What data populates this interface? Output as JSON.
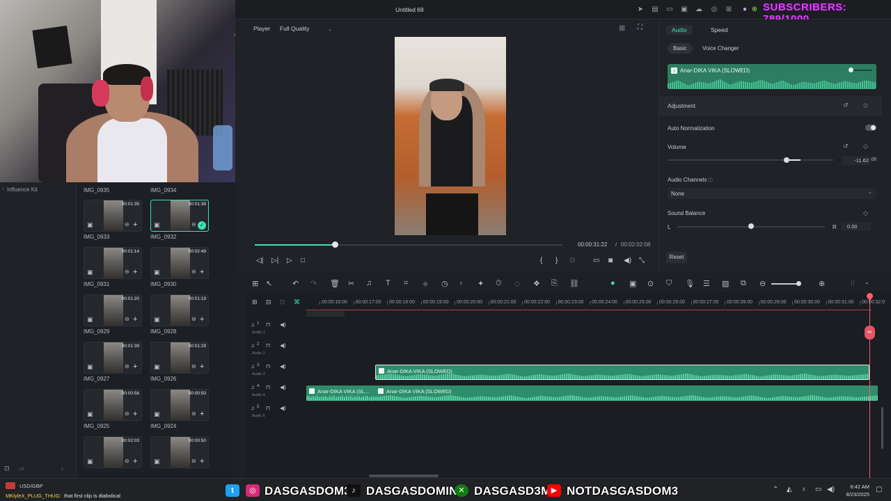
{
  "app": {
    "title": "Untitled 69"
  },
  "overlay": {
    "subscribers": "SUBSCRIBERS: 789/1000"
  },
  "left_panel": {
    "influence_kit": "Influence Kit"
  },
  "media": {
    "top_labels": [
      "IMG_0935",
      "IMG_0934"
    ],
    "items": [
      {
        "name": "IMG_0933",
        "duration": "00:01:35",
        "selected": false
      },
      {
        "name": "IMG_0932",
        "duration": "00:01:38",
        "selected": true
      },
      {
        "name": "IMG_0931",
        "duration": "00:01:14",
        "selected": false
      },
      {
        "name": "IMG_0930",
        "duration": "00:02:49",
        "selected": false
      },
      {
        "name": "IMG_0929",
        "duration": "00:01:20",
        "selected": false
      },
      {
        "name": "IMG_0928",
        "duration": "00:01:19",
        "selected": false
      },
      {
        "name": "IMG_0927",
        "duration": "00:01:39",
        "selected": false
      },
      {
        "name": "IMG_0926",
        "duration": "00:01:29",
        "selected": false
      },
      {
        "name": "IMG_0925",
        "duration": "00:00:56",
        "selected": false
      },
      {
        "name": "IMG_0924",
        "duration": "00:00:50",
        "selected": false
      },
      {
        "name": "",
        "duration": "00:02:03",
        "selected": false
      },
      {
        "name": "",
        "duration": "00:00:50",
        "selected": false
      }
    ]
  },
  "player": {
    "label": "Player",
    "quality": "Full Quality",
    "current_time": "00:00:31:22",
    "separator": "/",
    "total_time": "00:02:02:08",
    "progress": 0.26
  },
  "props": {
    "tabs": [
      "Audio",
      "Speed"
    ],
    "subtabs": [
      "Basic",
      "Voice Changer"
    ],
    "clip_name": "Anar-DIKA VIKA (SLOWED)",
    "adjustment": "Adjustment",
    "auto_normalization": "Auto Normalization",
    "volume": {
      "label": "Volume",
      "value": "-11.62",
      "unit": "dB",
      "level": 0.72
    },
    "audio_channels": {
      "label": "Audio Channels",
      "value": "None"
    },
    "sound_balance": {
      "label": "Sound Balance",
      "left": "L",
      "right": "R",
      "value": "0.00",
      "level": 0.5
    },
    "reset": "Reset"
  },
  "timeline": {
    "ticks": [
      "00:00:16:00",
      "00:00:17:00",
      "00:00:18:00",
      "00:00:19:00",
      "00:00:20:00",
      "00:00:21:00",
      "00:00:22:00",
      "00:00:23:00",
      "00:00:24:00",
      "00:00:25:00",
      "00:00:26:00",
      "00:00:27:00",
      "00:00:28:00",
      "00:00:29:00",
      "00:00:30:00",
      "00:00:31:00",
      "00:00:32:0"
    ],
    "tracks": [
      "Audio 1",
      "Audio 2",
      "Audio 3",
      "Audio 4",
      "Audio 5"
    ],
    "track_numbers": [
      "1",
      "2",
      "3",
      "4",
      "5"
    ],
    "clips": [
      {
        "label": "Anar-DIKA VIKA (SLOWED)",
        "track": 3,
        "selected": true
      },
      {
        "label": "Anar-DIKA VIKA (SL...",
        "track": 4,
        "selected": false
      },
      {
        "label": "Anar-DIKA VIKA (SLOWED)",
        "track": 4,
        "selected": false
      }
    ]
  },
  "taskbar": {
    "ticker": "USD/GBP",
    "chat_user": "MKlyleX_PLUG_THUG:",
    "chat_msg": "that first clip is diabolical",
    "socials": [
      "DASGASDOM3",
      "DASGASDOMINI",
      "DASGASD3M",
      "NOTDASGASDOM3"
    ],
    "time": "6:42 AM",
    "date": "8/23/2025"
  }
}
